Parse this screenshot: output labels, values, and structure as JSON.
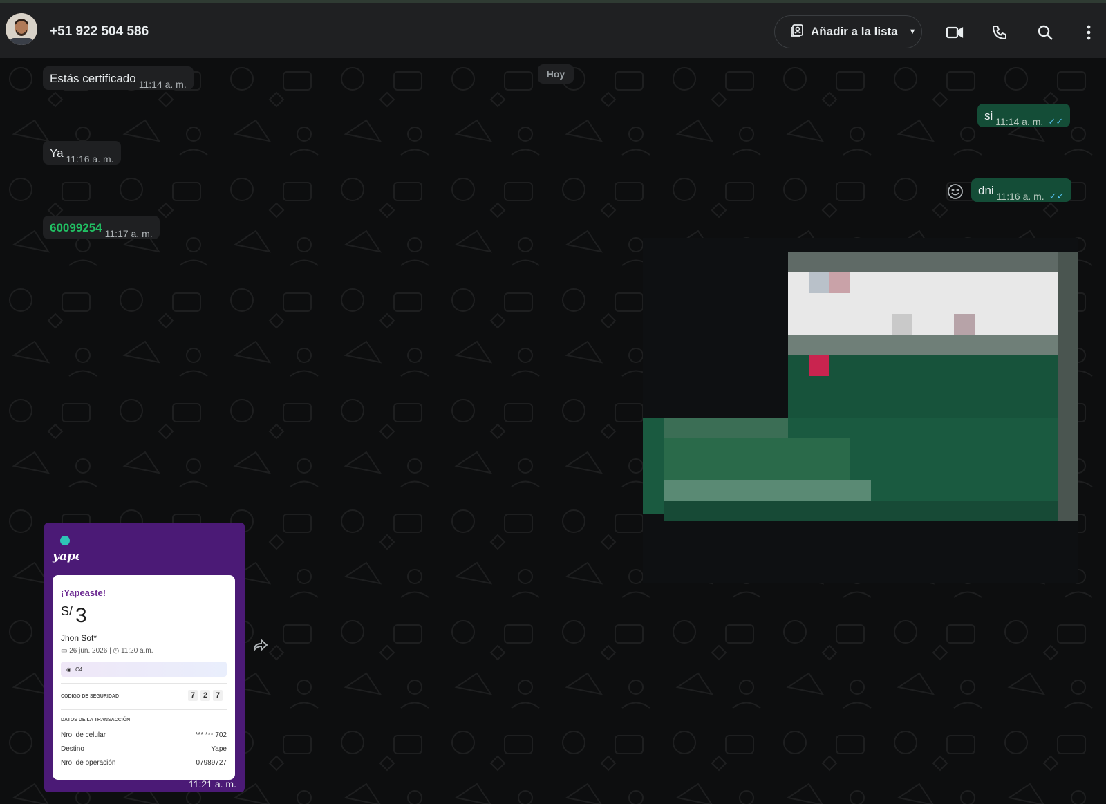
{
  "header": {
    "contact_name": "+51 922 504 586",
    "add_to_list_label": "Añadir a la lista",
    "icons": [
      "video-call-icon",
      "voice-call-icon",
      "search-icon",
      "more-options-icon"
    ]
  },
  "chat": {
    "date_chip": "Hoy",
    "messages": [
      {
        "direction": "in",
        "text": "Estás certificado",
        "time": "11:14 a. m."
      },
      {
        "direction": "out",
        "text": "si",
        "time": "11:14 a. m.",
        "ticks": "✓✓"
      },
      {
        "direction": "in",
        "text": "Ya",
        "time": "11:16 a. m."
      },
      {
        "direction": "out",
        "text": "dni",
        "time": "11:16 a. m.",
        "ticks": "✓✓"
      },
      {
        "direction": "in",
        "text": "60099254",
        "time": "11:17 a. m."
      }
    ],
    "receipt": {
      "logo_text": "yape",
      "title": "¡Yapeaste!",
      "currency": "S/",
      "amount": "3",
      "recipient": "Jhon Sot*",
      "date": "26 jun. 2026",
      "time": "11:20 a.m.",
      "message": "C4",
      "security_label": "CÓDIGO DE SEGURIDAD",
      "security_code": [
        "7",
        "2",
        "7"
      ],
      "transaction_label": "DATOS DE LA TRANSACCIÓN",
      "rows": [
        {
          "label": "Nro. de celular",
          "value": "*** *** 702"
        },
        {
          "label": "Destino",
          "value": "Yape"
        },
        {
          "label": "Nro. de operación",
          "value": "07989727"
        }
      ],
      "message_time": "11:21 a. m."
    }
  },
  "colors": {
    "incoming_bubble": "#1f2022",
    "outgoing_bubble": "#144d37",
    "link_green": "#21c063",
    "read_ticks": "#53bdeb",
    "yape_purple": "#4b1a76"
  }
}
